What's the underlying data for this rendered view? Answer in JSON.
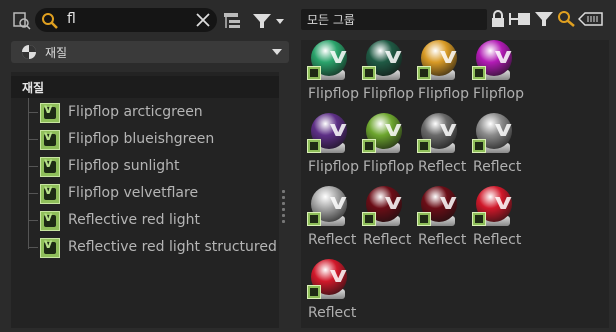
{
  "search": {
    "value": "fl"
  },
  "material_dropdown": {
    "label": "재질"
  },
  "tree": {
    "header": "재질",
    "items": [
      {
        "label": "Flipflop arcticgreen"
      },
      {
        "label": "Flipflop blueishgreen"
      },
      {
        "label": "Flipflop sunlight"
      },
      {
        "label": "Flipflop velvetflare"
      },
      {
        "label": "Reflective red light"
      },
      {
        "label": "Reflective red light structured"
      }
    ]
  },
  "group_filter": {
    "value": "모든 그룹"
  },
  "grid": {
    "tiles": [
      {
        "label": "Flipflop",
        "color": "#2aa36b"
      },
      {
        "label": "Flipflop",
        "color": "#1f5a44"
      },
      {
        "label": "Flipflop",
        "color": "#d89a25"
      },
      {
        "label": "Flipflop",
        "color": "#b21bb5"
      },
      {
        "label": "Flipflop",
        "color": "#5d2f86"
      },
      {
        "label": "Flipflop",
        "color": "#6da62e"
      },
      {
        "label": "Reflect",
        "color": "#6a6a6a"
      },
      {
        "label": "Reflect",
        "color": "#8a8a8a"
      },
      {
        "label": "Reflect",
        "color": "#a8a8a8"
      },
      {
        "label": "Reflect",
        "color": "#6b0d16"
      },
      {
        "label": "Reflect",
        "color": "#6b0d16"
      },
      {
        "label": "Reflect",
        "color": "#d0182a"
      },
      {
        "label": "Reflect",
        "color": "#d0182a"
      }
    ]
  }
}
